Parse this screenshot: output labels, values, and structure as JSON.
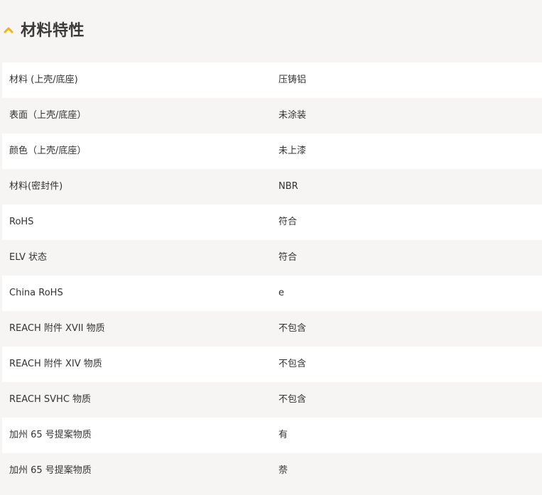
{
  "section": {
    "title": "材料特性",
    "icon": "chevron-up-icon",
    "accent_color": "#f5b400"
  },
  "rows": [
    {
      "label": "材料 (上壳/底座)",
      "value": "压铸铝"
    },
    {
      "label": "表面（上壳/底座）",
      "value": "未涂装"
    },
    {
      "label": "颜色（上壳/底座）",
      "value": "未上漆"
    },
    {
      "label": "材料(密封件)",
      "value": "NBR"
    },
    {
      "label": "RoHS",
      "value": "符合"
    },
    {
      "label": "ELV 状态",
      "value": "符合"
    },
    {
      "label": "China RoHS",
      "value": "e"
    },
    {
      "label": "REACH 附件 XVII 物质",
      "value": "不包含"
    },
    {
      "label": "REACH 附件 XIV 物质",
      "value": "不包含"
    },
    {
      "label": "REACH SVHC 物质",
      "value": "不包含"
    },
    {
      "label": "加州 65 号提案物质",
      "value": "有"
    },
    {
      "label": "加州 65 号提案物质",
      "value": "萘"
    }
  ]
}
